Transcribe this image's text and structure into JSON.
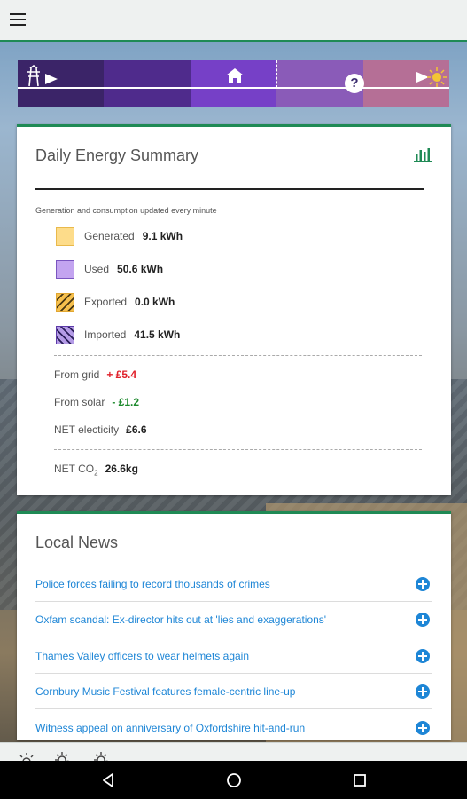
{
  "app": {
    "menu_icon": "hamburger-menu-icon",
    "accent": "#1f8a55"
  },
  "energy_flow": {
    "segments": [
      "#3b2468",
      "#4f2b8c",
      "#7640c7",
      "#8a5bb8",
      "#b56f96"
    ],
    "icons": [
      "pylon-icon",
      "home-icon",
      "help-icon",
      "sun-icon"
    ],
    "help_label": "?"
  },
  "summary": {
    "title": "Daily Energy Summary",
    "note": "Generation and consumption updated every minute",
    "legend": [
      {
        "label": "Generated",
        "value": "9.1 kWh",
        "color": "#fddc8a"
      },
      {
        "label": "Used",
        "value": "50.6 kWh",
        "color": "#c3a4f0"
      },
      {
        "label": "Exported",
        "value": "0.0 kWh",
        "color": "#f6c04d"
      },
      {
        "label": "Imported",
        "value": "41.5 kWh",
        "color": "#2c1f5c"
      }
    ],
    "from_grid": {
      "label": "From grid",
      "value": "+ £5.4"
    },
    "from_solar": {
      "label": "From solar",
      "value": "- £1.2"
    },
    "net_electricity": {
      "label": "NET electicity",
      "value": "£6.6"
    },
    "net_co2": {
      "label": "NET CO",
      "sub": "2",
      "value": "26.6kg"
    }
  },
  "news": {
    "title": "Local News",
    "items": [
      "Police forces failing to record thousands of crimes",
      "Oxfam scandal: Ex-director hits out at 'lies and exaggerations'",
      "Thames Valley officers to wear helmets again",
      "Cornbury Music Festival features female-centric line-up",
      "Witness appeal on anniversary of Oxfordshire hit-and-run"
    ]
  },
  "weather": {
    "icons": [
      "sun-icon",
      "sun-cloud-icon",
      "sun-cloud-icon"
    ]
  },
  "navbar": {
    "icons": [
      "back-icon",
      "home-circle-icon",
      "recents-icon"
    ]
  }
}
